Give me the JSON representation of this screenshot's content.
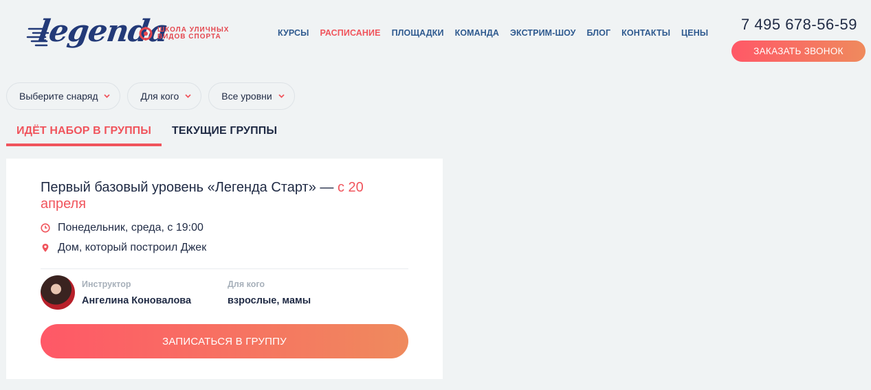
{
  "header": {
    "logo_text": "legenda",
    "logo_subtitle": "школа уличных видов спорта",
    "nav": [
      "КУРСЫ",
      "РАСПИСАНИЕ",
      "ПЛОЩАДКИ",
      "КОМАНДА",
      "ЭКСТРИМ-ШОУ",
      "БЛОГ",
      "КОНТАКТЫ",
      "ЦЕНЫ"
    ],
    "active_nav": "РАСПИСАНИЕ",
    "phone": "7 495 678-56-59",
    "call_button": "ЗАКАЗАТЬ ЗВОНОК"
  },
  "filters": [
    {
      "label": "Выберите снаряд",
      "icon": "chevron-down-icon"
    },
    {
      "label": "Для кого",
      "icon": "chevron-down-icon"
    },
    {
      "label": "Все уровни",
      "icon": "chevron-down-icon"
    }
  ],
  "tabs": [
    {
      "label": "ИДЁТ НАБОР В ГРУППЫ",
      "active": true
    },
    {
      "label": "ТЕКУЩИЕ ГРУППЫ",
      "active": false
    }
  ],
  "card": {
    "title": "Первый базовый уровень «Легенда Старт» — ",
    "title_date": "с 20 апреля",
    "schedule": "Понедельник, среда, с 19:00",
    "schedule_icon": "clock-icon",
    "location": "Дом, который построил Джек",
    "location_icon": "map-pin-icon",
    "instructor_label": "Инструктор",
    "instructor_name": "Ангелина Коновалова",
    "audience_label": "Для кого",
    "audience_value": "взрослые, мамы",
    "join_button": "ЗАПИСАТЬСЯ В ГРУППУ"
  },
  "colors": {
    "accent": "#f0545c",
    "nav_text": "#2f5a8f",
    "dark_text": "#1f2a44",
    "logo_blue": "#233a78",
    "gradient_start": "#ff5867",
    "gradient_end": "#ef8a5d",
    "background": "#f0f3f4"
  }
}
